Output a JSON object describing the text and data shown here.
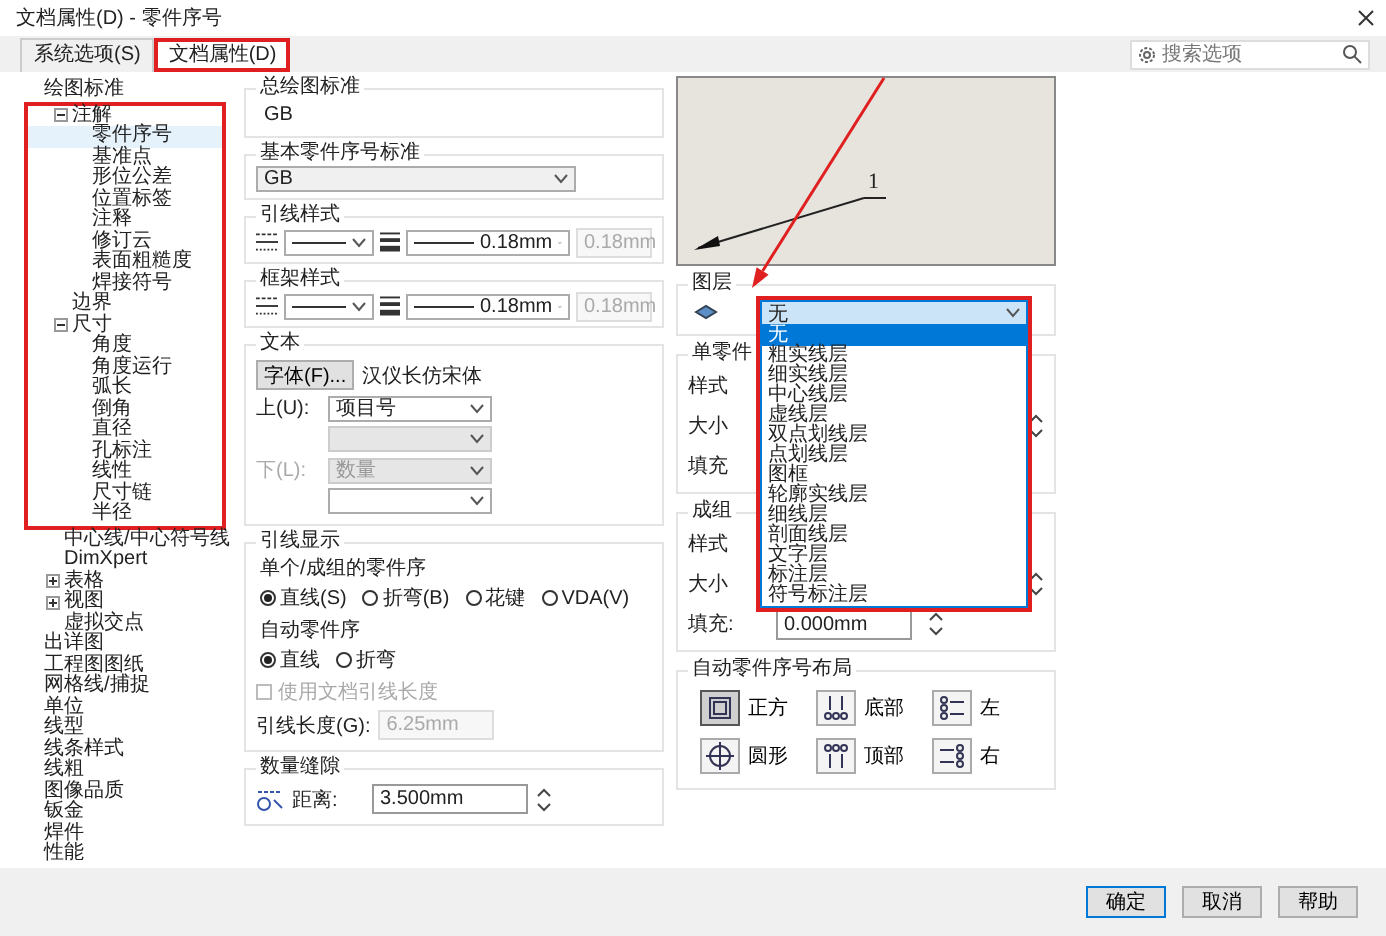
{
  "window": {
    "title": "文档属性(D) - 零件序号"
  },
  "tabs": [
    {
      "label": "系统选项(S)",
      "selected": false,
      "highlighted": false
    },
    {
      "label": "文档属性(D)",
      "selected": true,
      "highlighted": true
    }
  ],
  "search": {
    "placeholder": "搜索选项"
  },
  "tree": [
    {
      "label": "绘图标准",
      "selected": false,
      "children": [
        {
          "label": "注解",
          "selected": false,
          "expanded": true,
          "highlighted": true,
          "children": [
            {
              "label": "零件序号",
              "selected": true
            },
            {
              "label": "基准点",
              "selected": false
            },
            {
              "label": "形位公差",
              "selected": false
            },
            {
              "label": "位置标签",
              "selected": false
            },
            {
              "label": "注释",
              "selected": false
            },
            {
              "label": "修订云",
              "selected": false
            },
            {
              "label": "表面粗糙度",
              "selected": false
            },
            {
              "label": "焊接符号",
              "selected": false
            }
          ]
        },
        {
          "label": "边界",
          "selected": false,
          "highlighted": true
        },
        {
          "label": "尺寸",
          "selected": false,
          "expanded": true,
          "highlighted": true,
          "children": [
            {
              "label": "角度",
              "selected": false
            },
            {
              "label": "角度运行",
              "selected": false
            },
            {
              "label": "弧长",
              "selected": false
            },
            {
              "label": "倒角",
              "selected": false
            },
            {
              "label": "直径",
              "selected": false
            },
            {
              "label": "孔标注",
              "selected": false
            },
            {
              "label": "线性",
              "selected": false
            },
            {
              "label": "尺寸链",
              "selected": false
            },
            {
              "label": "半径",
              "selected": false
            }
          ]
        },
        {
          "label": "中心线/中心符号线",
          "selected": false,
          "highlighted": false
        },
        {
          "label": "DimXpert",
          "selected": false,
          "highlighted": false
        },
        {
          "label": "表格",
          "selected": false,
          "expanded": false,
          "highlighted": false
        },
        {
          "label": "视图",
          "selected": false,
          "expanded": false,
          "highlighted": false
        },
        {
          "label": "虚拟交点",
          "selected": false,
          "highlighted": false
        }
      ]
    },
    {
      "label": "出详图",
      "selected": false
    },
    {
      "label": "工程图图纸",
      "selected": false
    },
    {
      "label": "网格线/捕捉",
      "selected": false
    },
    {
      "label": "单位",
      "selected": false
    },
    {
      "label": "线型",
      "selected": false
    },
    {
      "label": "线条样式",
      "selected": false
    },
    {
      "label": "线粗",
      "selected": false
    },
    {
      "label": "图像品质",
      "selected": false
    },
    {
      "label": "钣金",
      "selected": false
    },
    {
      "label": "焊件",
      "selected": false
    },
    {
      "label": "性能",
      "selected": false
    }
  ],
  "drawing_standard": {
    "title": "总绘图标准",
    "value": "GB"
  },
  "balloon_standard": {
    "title": "基本零件序号标准",
    "value": "GB"
  },
  "leader_style": {
    "title": "引线样式",
    "thickness": "0.18mm",
    "custom": "0.18mm"
  },
  "frame_style": {
    "title": "框架样式",
    "thickness": "0.18mm",
    "custom": "0.18mm"
  },
  "text": {
    "title": "文本",
    "font_button": "字体(F)...",
    "font_name": "汉仪长仿宋体",
    "fields": [
      {
        "label": "上(U):",
        "value": "项目号",
        "disabled": false
      },
      {
        "disabled": true
      },
      {
        "label": "下(L):",
        "value": "数量",
        "disabled": true
      },
      {
        "disabled": false
      }
    ]
  },
  "leader_display": {
    "title": "引线显示",
    "groups": [
      {
        "label": "单个/成组的零件序",
        "options": [
          {
            "label": "直线(S)",
            "selected": true
          },
          {
            "label": "折弯(B)",
            "selected": false
          },
          {
            "label": "花键",
            "selected": false
          },
          {
            "label": "VDA(V)",
            "selected": false
          }
        ]
      },
      {
        "label": "自动零件序",
        "options": [
          {
            "label": "直线",
            "selected": true
          },
          {
            "label": "折弯",
            "selected": false
          }
        ]
      }
    ],
    "use_doc_length": {
      "label": "使用文档引线长度",
      "checked": false,
      "disabled": true
    },
    "length": {
      "label": "引线长度(G):",
      "value": "6.25mm",
      "disabled": true
    }
  },
  "quantity_spacing": {
    "title": "数量缝隙",
    "label": "距离:",
    "value": "3.500mm"
  },
  "preview": {
    "balloon_number": "1"
  },
  "layer": {
    "title": "图层",
    "value": "无",
    "expanded": true,
    "highlighted": true,
    "options": [
      {
        "label": "无",
        "selected": true
      },
      {
        "label": "粗实线层",
        "selected": false
      },
      {
        "label": "细实线层",
        "selected": false
      },
      {
        "label": "中心线层",
        "selected": false
      },
      {
        "label": "虚线层",
        "selected": false
      },
      {
        "label": "双点划线层",
        "selected": false
      },
      {
        "label": "点划线层",
        "selected": false
      },
      {
        "label": "图框",
        "selected": false
      },
      {
        "label": "轮廓实线层",
        "selected": false
      },
      {
        "label": "细线层",
        "selected": false
      },
      {
        "label": "剖面线层",
        "selected": false
      },
      {
        "label": "文字层",
        "selected": false
      },
      {
        "label": "标注层",
        "selected": false
      },
      {
        "label": "符号标注层",
        "selected": false
      }
    ]
  },
  "single_balloon": {
    "title": "单零件",
    "labels": [
      "样式",
      "大小",
      "填充"
    ]
  },
  "stacked_balloon": {
    "title": "成组",
    "labels": [
      "样式",
      "大小"
    ],
    "fill_label": "填充:",
    "fill_value": "0.000mm"
  },
  "auto_layout": {
    "title": "自动零件序号布局",
    "options": [
      {
        "label": "正方",
        "kind": "square",
        "selected": true
      },
      {
        "label": "底部",
        "kind": "bottom",
        "selected": false
      },
      {
        "label": "左",
        "kind": "left",
        "selected": false
      },
      {
        "label": "圆形",
        "kind": "circle",
        "selected": false
      },
      {
        "label": "顶部",
        "kind": "top",
        "selected": false
      },
      {
        "label": "右",
        "kind": "right",
        "selected": false
      }
    ]
  },
  "buttons": [
    {
      "label": "确定",
      "default": true
    },
    {
      "label": "取消",
      "default": false
    },
    {
      "label": "帮助",
      "default": false
    }
  ]
}
